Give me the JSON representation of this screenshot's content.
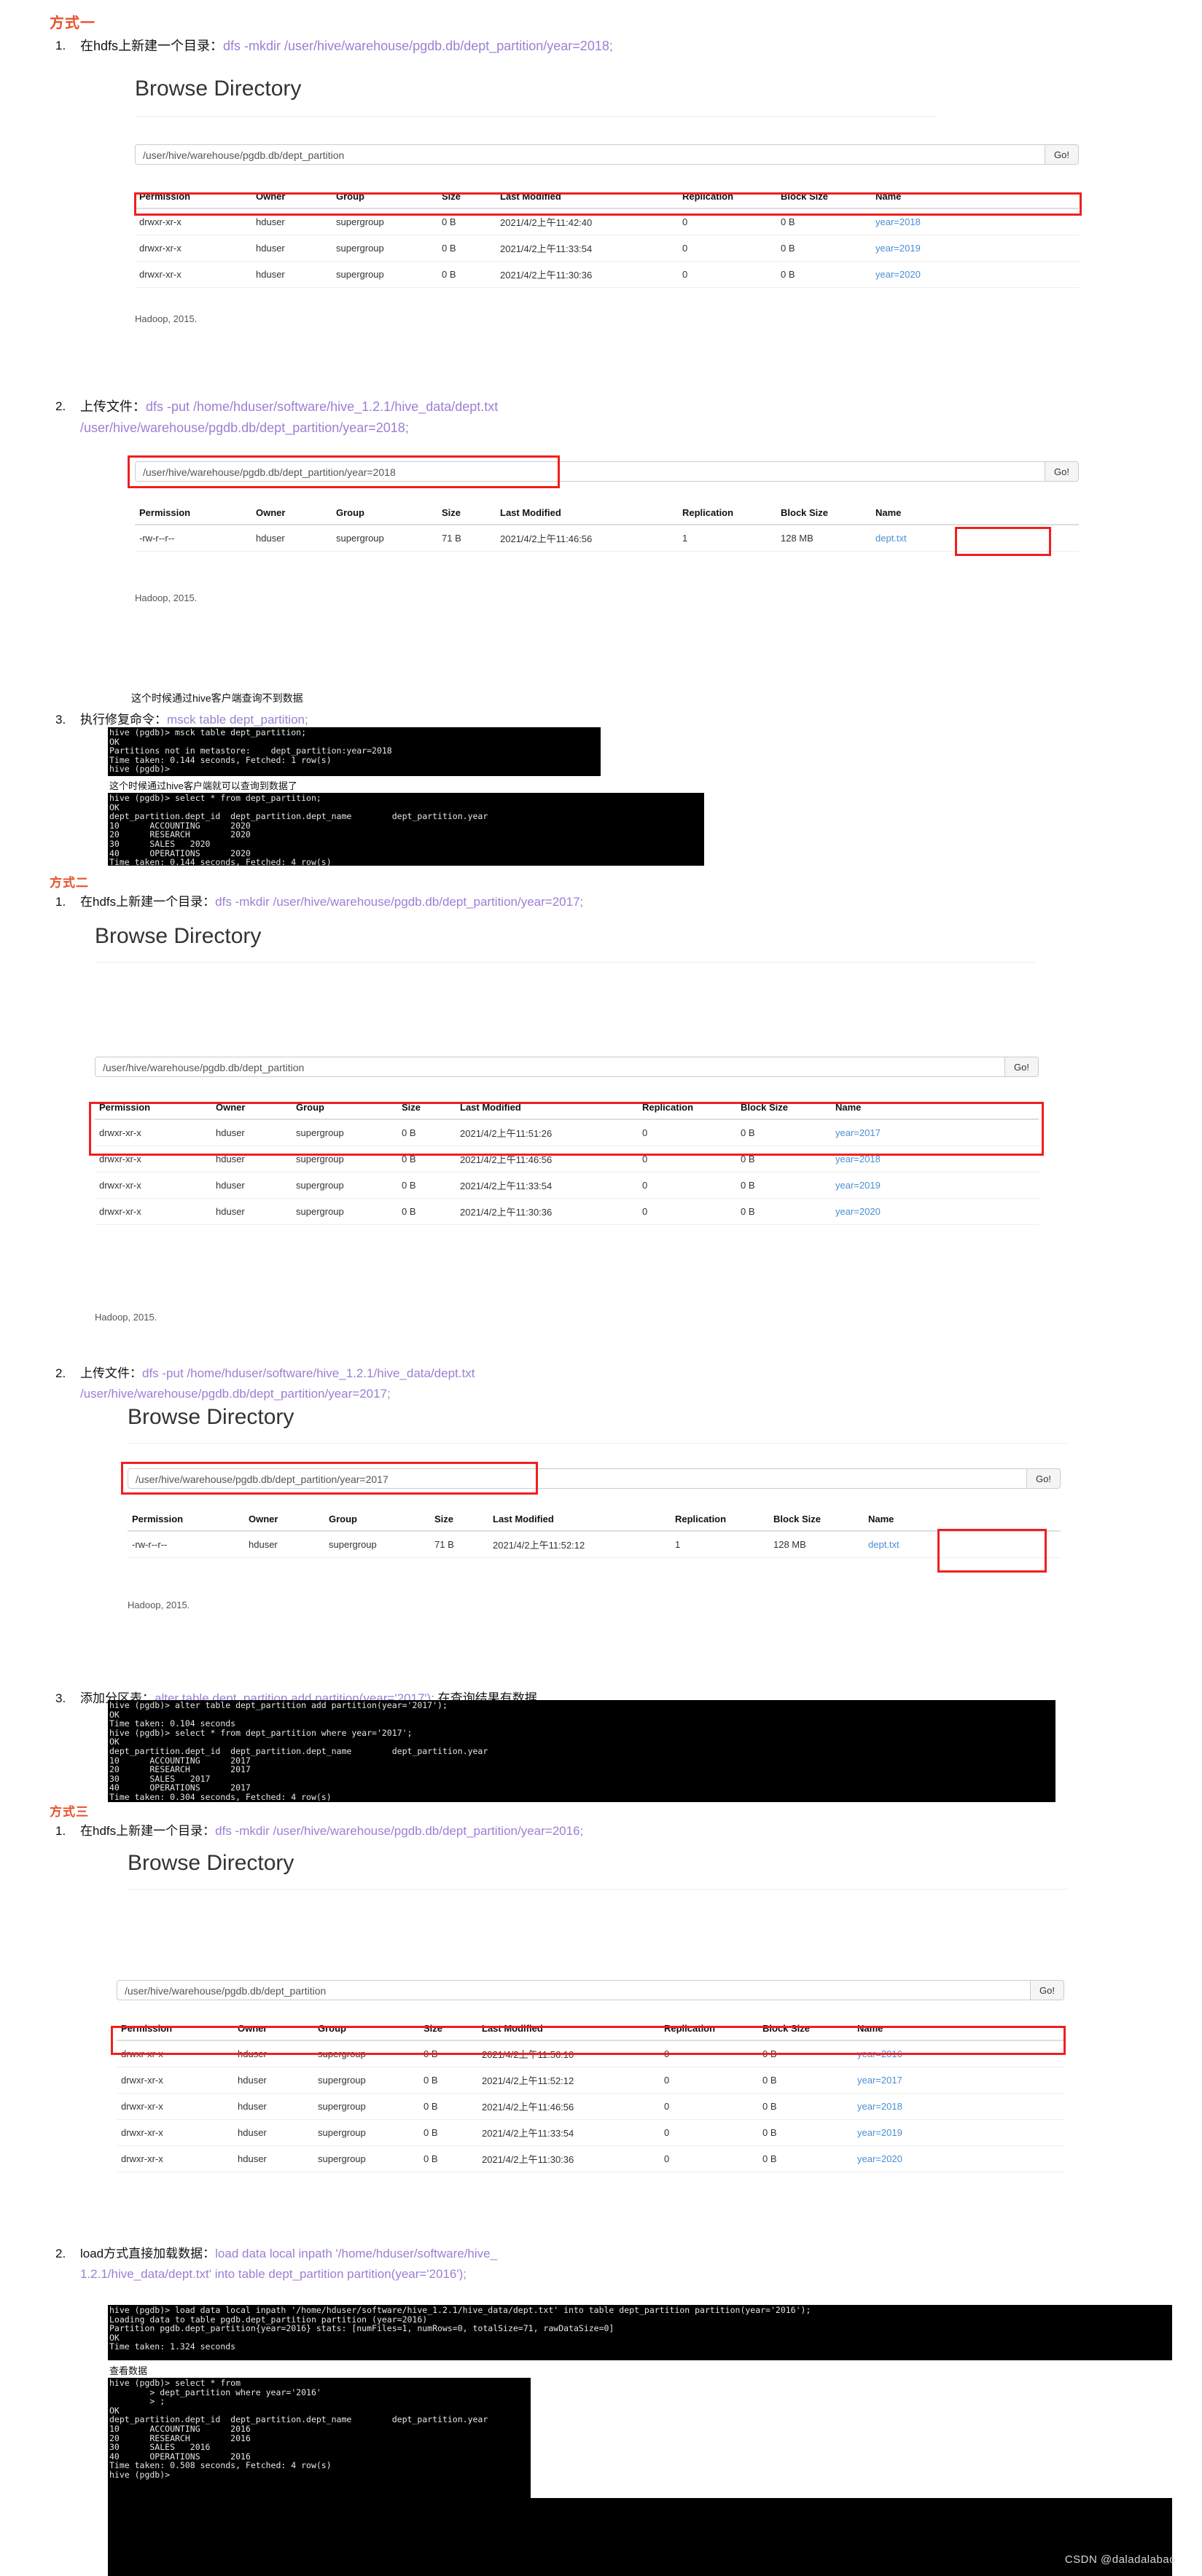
{
  "watermark": "CSDN @daladalabao",
  "browse_title": "Browse Directory",
  "go_label": "Go!",
  "hadoop_footer": "Hadoop, 2015.",
  "table_headers": [
    "Permission",
    "Owner",
    "Group",
    "Size",
    "Last Modified",
    "Replication",
    "Block Size",
    "Name"
  ],
  "sections": [
    {
      "title": "方式一",
      "step1": {
        "num": "1.",
        "label": "在hdfs上新建一个目录：",
        "cmd": "dfs -mkdir /user/hive/warehouse/pgdb.db/dept_partition/year=2018;"
      },
      "panel1": {
        "path": "/user/hive/warehouse/pgdb.db/dept_partition",
        "rows": [
          {
            "permission": "drwxr-xr-x",
            "owner": "hduser",
            "group": "supergroup",
            "size": "0 B",
            "modified": "2021/4/2上午11:42:40",
            "replication": "0",
            "blocksize": "0 B",
            "name": "year=2018"
          },
          {
            "permission": "drwxr-xr-x",
            "owner": "hduser",
            "group": "supergroup",
            "size": "0 B",
            "modified": "2021/4/2上午11:33:54",
            "replication": "0",
            "blocksize": "0 B",
            "name": "year=2019"
          },
          {
            "permission": "drwxr-xr-x",
            "owner": "hduser",
            "group": "supergroup",
            "size": "0 B",
            "modified": "2021/4/2上午11:30:36",
            "replication": "0",
            "blocksize": "0 B",
            "name": "year=2020"
          }
        ]
      },
      "step2": {
        "num": "2.",
        "label": "上传文件：",
        "cmd_line1": "dfs -put /home/hduser/software/hive_1.2.1/hive_data/dept.txt",
        "cmd_line2": "/user/hive/warehouse/pgdb.db/dept_partition/year=2018;"
      },
      "panel2": {
        "path": "/user/hive/warehouse/pgdb.db/dept_partition/year=2018",
        "rows": [
          {
            "permission": "-rw-r--r--",
            "owner": "hduser",
            "group": "supergroup",
            "size": "71 B",
            "modified": "2021/4/2上午11:46:56",
            "replication": "1",
            "blocksize": "128 MB",
            "name": "dept.txt"
          }
        ]
      },
      "note1": "这个时候通过hive客户端查询不到数据",
      "step3": {
        "num": "3.",
        "label": "执行修复命令：",
        "cmd": "msck table dept_partition;"
      },
      "term1": "hive (pgdb)> msck table dept_partition;\nOK\nPartitions not in metastore:\tdept_partition:year=2018\nTime taken: 0.144 seconds, Fetched: 1 row(s)\nhive (pgdb)>",
      "note2": "这个时候通过hive客户端就可以查询到数据了",
      "term2": "hive (pgdb)> select * from dept_partition;\nOK\ndept_partition.dept_id  dept_partition.dept_name        dept_partition.year\n10      ACCOUNTING      2020\n20      RESEARCH        2020\n30      SALES   2020\n40      OPERATIONS      2020\nTime taken: 0.144 seconds, Fetched: 4 row(s)"
    },
    {
      "title": "方式二",
      "step1": {
        "num": "1.",
        "label": "在hdfs上新建一个目录：",
        "cmd": "dfs -mkdir /user/hive/warehouse/pgdb.db/dept_partition/year=2017;"
      },
      "panel1": {
        "path": "/user/hive/warehouse/pgdb.db/dept_partition",
        "rows": [
          {
            "permission": "drwxr-xr-x",
            "owner": "hduser",
            "group": "supergroup",
            "size": "0 B",
            "modified": "2021/4/2上午11:51:26",
            "replication": "0",
            "blocksize": "0 B",
            "name": "year=2017"
          },
          {
            "permission": "drwxr-xr-x",
            "owner": "hduser",
            "group": "supergroup",
            "size": "0 B",
            "modified": "2021/4/2上午11:46:56",
            "replication": "0",
            "blocksize": "0 B",
            "name": "year=2018"
          },
          {
            "permission": "drwxr-xr-x",
            "owner": "hduser",
            "group": "supergroup",
            "size": "0 B",
            "modified": "2021/4/2上午11:33:54",
            "replication": "0",
            "blocksize": "0 B",
            "name": "year=2019"
          },
          {
            "permission": "drwxr-xr-x",
            "owner": "hduser",
            "group": "supergroup",
            "size": "0 B",
            "modified": "2021/4/2上午11:30:36",
            "replication": "0",
            "blocksize": "0 B",
            "name": "year=2020"
          }
        ]
      },
      "step2": {
        "num": "2.",
        "label": "上传文件：",
        "cmd_line1": "dfs -put /home/hduser/software/hive_1.2.1/hive_data/dept.txt",
        "cmd_line2": "/user/hive/warehouse/pgdb.db/dept_partition/year=2017;"
      },
      "panel2": {
        "path": "/user/hive/warehouse/pgdb.db/dept_partition/year=2017",
        "rows": [
          {
            "permission": "-rw-r--r--",
            "owner": "hduser",
            "group": "supergroup",
            "size": "71 B",
            "modified": "2021/4/2上午11:52:12",
            "replication": "1",
            "blocksize": "128 MB",
            "name": "dept.txt"
          }
        ]
      },
      "step3": {
        "num": "3.",
        "label": "添加分区表：",
        "cmd": "alter table dept_partition add partition(year='2017');",
        "suffix": "在查询结果有数据"
      },
      "term1": "hive (pgdb)> alter table dept_partition add partition(year='2017');\nOK\nTime taken: 0.104 seconds\nhive (pgdb)> select * from dept_partition where year='2017';\nOK\ndept_partition.dept_id  dept_partition.dept_name        dept_partition.year\n10      ACCOUNTING      2017\n20      RESEARCH        2017\n30      SALES   2017\n40      OPERATIONS      2017\nTime taken: 0.304 seconds, Fetched: 4 row(s)"
    },
    {
      "title": "方式三",
      "step1": {
        "num": "1.",
        "label": "在hdfs上新建一个目录：",
        "cmd": "dfs -mkdir /user/hive/warehouse/pgdb.db/dept_partition/year=2016;"
      },
      "panel1": {
        "path": "/user/hive/warehouse/pgdb.db/dept_partition",
        "rows": [
          {
            "permission": "drwxr-xr-x",
            "owner": "hduser",
            "group": "supergroup",
            "size": "0 B",
            "modified": "2021/4/2上午11:56:10",
            "replication": "0",
            "blocksize": "0 B",
            "name": "year=2016"
          },
          {
            "permission": "drwxr-xr-x",
            "owner": "hduser",
            "group": "supergroup",
            "size": "0 B",
            "modified": "2021/4/2上午11:52:12",
            "replication": "0",
            "blocksize": "0 B",
            "name": "year=2017"
          },
          {
            "permission": "drwxr-xr-x",
            "owner": "hduser",
            "group": "supergroup",
            "size": "0 B",
            "modified": "2021/4/2上午11:46:56",
            "replication": "0",
            "blocksize": "0 B",
            "name": "year=2018"
          },
          {
            "permission": "drwxr-xr-x",
            "owner": "hduser",
            "group": "supergroup",
            "size": "0 B",
            "modified": "2021/4/2上午11:33:54",
            "replication": "0",
            "blocksize": "0 B",
            "name": "year=2019"
          },
          {
            "permission": "drwxr-xr-x",
            "owner": "hduser",
            "group": "supergroup",
            "size": "0 B",
            "modified": "2021/4/2上午11:30:36",
            "replication": "0",
            "blocksize": "0 B",
            "name": "year=2020"
          }
        ]
      },
      "step2": {
        "num": "2.",
        "label": "load方式直接加载数据：",
        "cmd_line1": "load data local inpath '/home/hduser/software/hive_",
        "cmd_line2": "1.2.1/hive_data/dept.txt' into table dept_partition partition(year='2016');"
      },
      "term1": "hive (pgdb)> load data local inpath '/home/hduser/software/hive_1.2.1/hive_data/dept.txt' into table dept_partition partition(year='2016');\nLoading data to table pgdb.dept_partition partition (year=2016)\nPartition pgdb.dept_partition{year=2016} stats: [numFiles=1, numRows=0, totalSize=71, rawDataSize=0]\nOK\nTime taken: 1.324 seconds",
      "note1": "查看数据",
      "term2": "hive (pgdb)> select * from\n        > dept_partition where year='2016'\n        > ;\nOK\ndept_partition.dept_id  dept_partition.dept_name        dept_partition.year\n10      ACCOUNTING      2016\n20      RESEARCH        2016\n30      SALES   2016\n40      OPERATIONS      2016\nTime taken: 0.508 seconds, Fetched: 4 row(s)\nhive (pgdb)>"
    }
  ]
}
